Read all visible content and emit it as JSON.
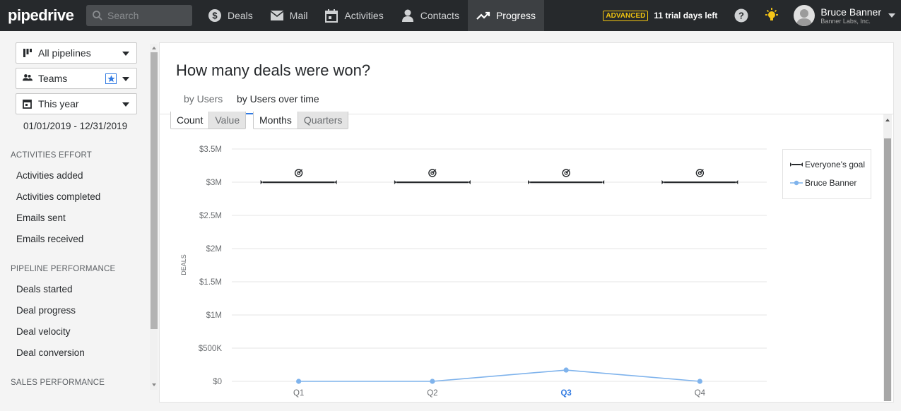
{
  "app": {
    "logo": "pipedrive"
  },
  "search": {
    "placeholder": "Search"
  },
  "nav": [
    {
      "label": "Deals",
      "icon": "dollar-icon"
    },
    {
      "label": "Mail",
      "icon": "mail-icon"
    },
    {
      "label": "Activities",
      "icon": "calendar-icon"
    },
    {
      "label": "Contacts",
      "icon": "person-icon"
    },
    {
      "label": "Progress",
      "icon": "trend-icon",
      "active": true
    }
  ],
  "account": {
    "plan_badge": "ADVANCED",
    "trial": "11 trial days left",
    "user_name": "Bruce Banner",
    "company": "Banner Labs, Inc."
  },
  "filters": {
    "pipeline": "All pipelines",
    "team": "Teams",
    "period": "This year",
    "date_range": "01/01/2019 - 12/31/2019"
  },
  "sidebar": {
    "sections": [
      {
        "title": "ACTIVITIES EFFORT",
        "items": [
          "Activities added",
          "Activities completed",
          "Emails sent",
          "Emails received"
        ]
      },
      {
        "title": "PIPELINE PERFORMANCE",
        "items": [
          "Deals started",
          "Deal progress",
          "Deal velocity",
          "Deal conversion"
        ]
      },
      {
        "title": "SALES PERFORMANCE",
        "items": []
      }
    ]
  },
  "report": {
    "title": "How many deals were won?",
    "tabs": [
      "by Users",
      "by Users over time"
    ],
    "active_tab": 1,
    "metric_toggle": [
      "Count",
      "Value"
    ],
    "active_metric": "Value",
    "interval_toggle": [
      "Months",
      "Quarters"
    ],
    "active_interval": "Quarters"
  },
  "colors": {
    "accent": "#317ae2",
    "series": "#7fb3ec",
    "goal": "#26292c",
    "topbar": "#26292c"
  },
  "chart_data": {
    "type": "line",
    "ylabel": "DEALS",
    "categories": [
      "Q1",
      "Q2",
      "Q3",
      "Q4"
    ],
    "highlight_category": "Q3",
    "yticks": [
      "$0",
      "$500K",
      "$1M",
      "$1.5M",
      "$2M",
      "$2.5M",
      "$3M",
      "$3.5M"
    ],
    "ylim": [
      0,
      3500000
    ],
    "goal": {
      "name": "Everyone's goal",
      "value": 3000000
    },
    "series": [
      {
        "name": "Bruce Banner",
        "values": [
          0,
          0,
          170000,
          0
        ]
      }
    ],
    "grid": true,
    "legend": "right"
  }
}
